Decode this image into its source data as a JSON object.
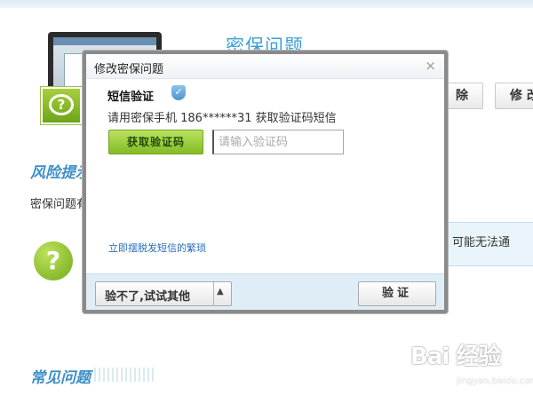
{
  "background": {
    "page_title": "密保问题",
    "buttons": [
      {
        "label": "除"
      },
      {
        "label": "修 改"
      }
    ],
    "risk_title": "风险提示",
    "risk_text": "密保问题有",
    "info_text": "录，可能无法通",
    "faq_title": "常见问题",
    "watermark": "Bai 经验",
    "watermark_sub": "jingyan.baidu.com"
  },
  "dialog": {
    "title": "修改密保问题",
    "close_glyph": "×",
    "section_title": "短信验证",
    "instruction": "请用密保手机 186******31 获取验证码短信",
    "get_code_label": "获取验证码",
    "code_placeholder": "请输入验证码",
    "escape_link": "立即摆脱发短信的繁琐",
    "try_other_label": "验不了,试试其他",
    "try_other_arrow": "▲",
    "verify_label": "验证"
  },
  "colors": {
    "accent_blue": "#3aa0d8",
    "link_blue": "#2a6eb8",
    "green_button": "#84bb25",
    "footer_bg": "#dfedf6"
  },
  "icons": [
    "help-question-icon",
    "shield-icon",
    "close-icon",
    "caret-up-icon",
    "laptop-illustration"
  ]
}
